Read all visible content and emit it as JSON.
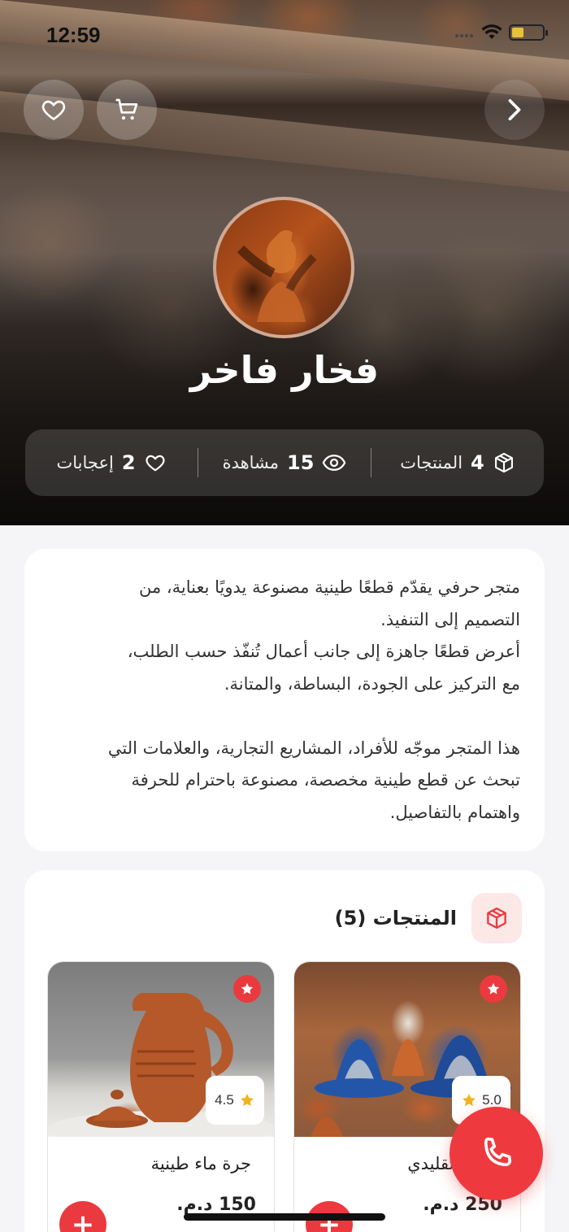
{
  "status_bar": {
    "time": "12:59"
  },
  "shop": {
    "name": "فخار فاخر"
  },
  "stats": [
    {
      "value": "4",
      "label": "المنتجات",
      "icon": "box-icon"
    },
    {
      "value": "15",
      "label": "مشاهدة",
      "icon": "eye-icon"
    },
    {
      "value": "2",
      "label": "إعجابات",
      "icon": "heart-icon"
    }
  ],
  "description": {
    "lines": [
      "متجر حرفي يقدّم قطعًا طينية مصنوعة يدويًا بعناية، من",
      "التصميم إلى التنفيذ.",
      "أعرض قطعًا جاهزة إلى جانب أعمال تُنفّذ حسب الطلب،",
      "مع التركيز على الجودة، البساطة، والمتانة.",
      "",
      "هذا المتجر موجّه للأفراد، المشاريع التجارية، والعلامات التي",
      "تبحث عن قطع طينية مخصصة، مصنوعة باحترام للحرفة",
      "واهتمام بالتفاصيل."
    ]
  },
  "products_section": {
    "title": "المنتجات (5)"
  },
  "products": [
    {
      "name": "طيني تقليدي",
      "price": "250 د.م.",
      "rating": "5.0",
      "add_label": "+"
    },
    {
      "name": "جرة ماء طينية",
      "price": "150 د.م.",
      "rating": "4.5",
      "add_label": "+"
    }
  ],
  "colors": {
    "accent": "#ea3a3f",
    "card_bg": "#ffffff",
    "page_bg": "#f5f5f7"
  }
}
